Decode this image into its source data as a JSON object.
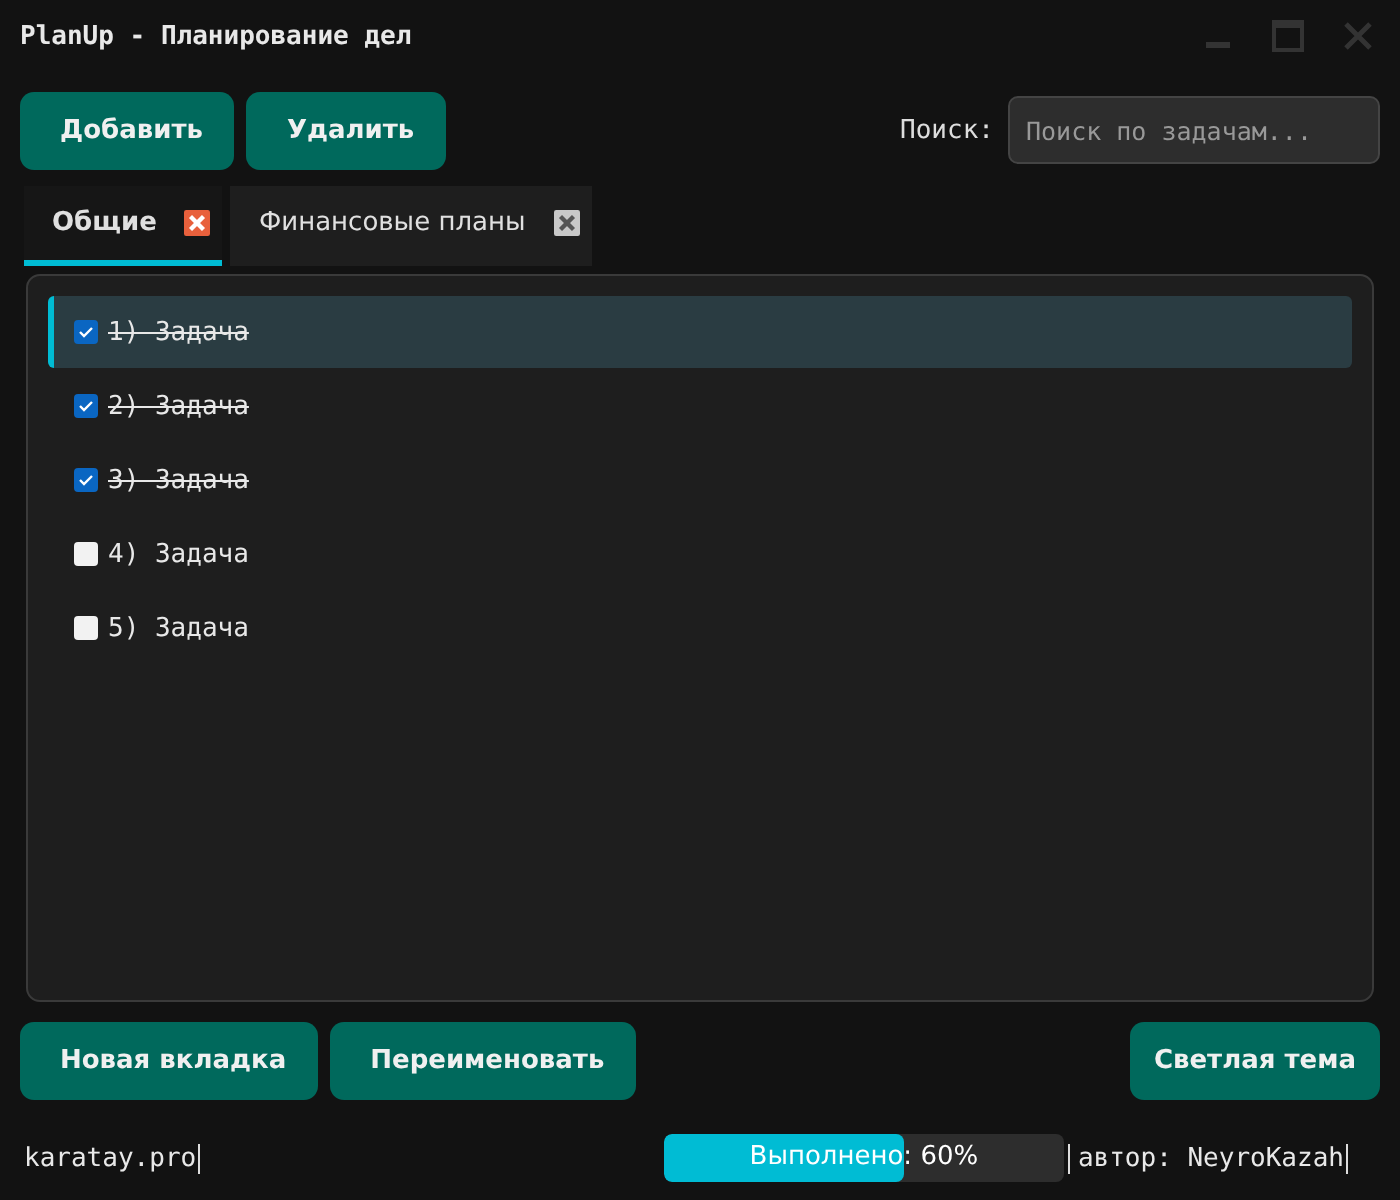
{
  "window": {
    "title": "PlanUp - Планирование дел"
  },
  "toolbar": {
    "buttons": [
      "Добавить",
      "Удалить"
    ],
    "search_label": "Поиск:",
    "search": {
      "placeholder": "Поиск по задачам..."
    }
  },
  "tabs": [
    {
      "label": "Общие",
      "selected": true
    },
    {
      "label": "Финансовые планы",
      "selected": false
    }
  ],
  "tasks": [
    {
      "label": "1) Задача",
      "checked": true,
      "selected": true
    },
    {
      "label": "2) Задача",
      "checked": true,
      "selected": false
    },
    {
      "label": "3) Задача",
      "checked": true,
      "selected": false
    },
    {
      "label": "4) Задача",
      "checked": false,
      "selected": false
    },
    {
      "label": "5) Задача",
      "checked": false,
      "selected": false
    }
  ],
  "bottom_buttons": {
    "left": [
      "Новая вкладка",
      "Переименовать"
    ],
    "right": "Светлая тема"
  },
  "status_bar": {
    "site": "karatay.pro",
    "progress": {
      "label": "Выполнено: 60%",
      "level": 0.6
    },
    "author": "автор: NeyroKazah"
  }
}
